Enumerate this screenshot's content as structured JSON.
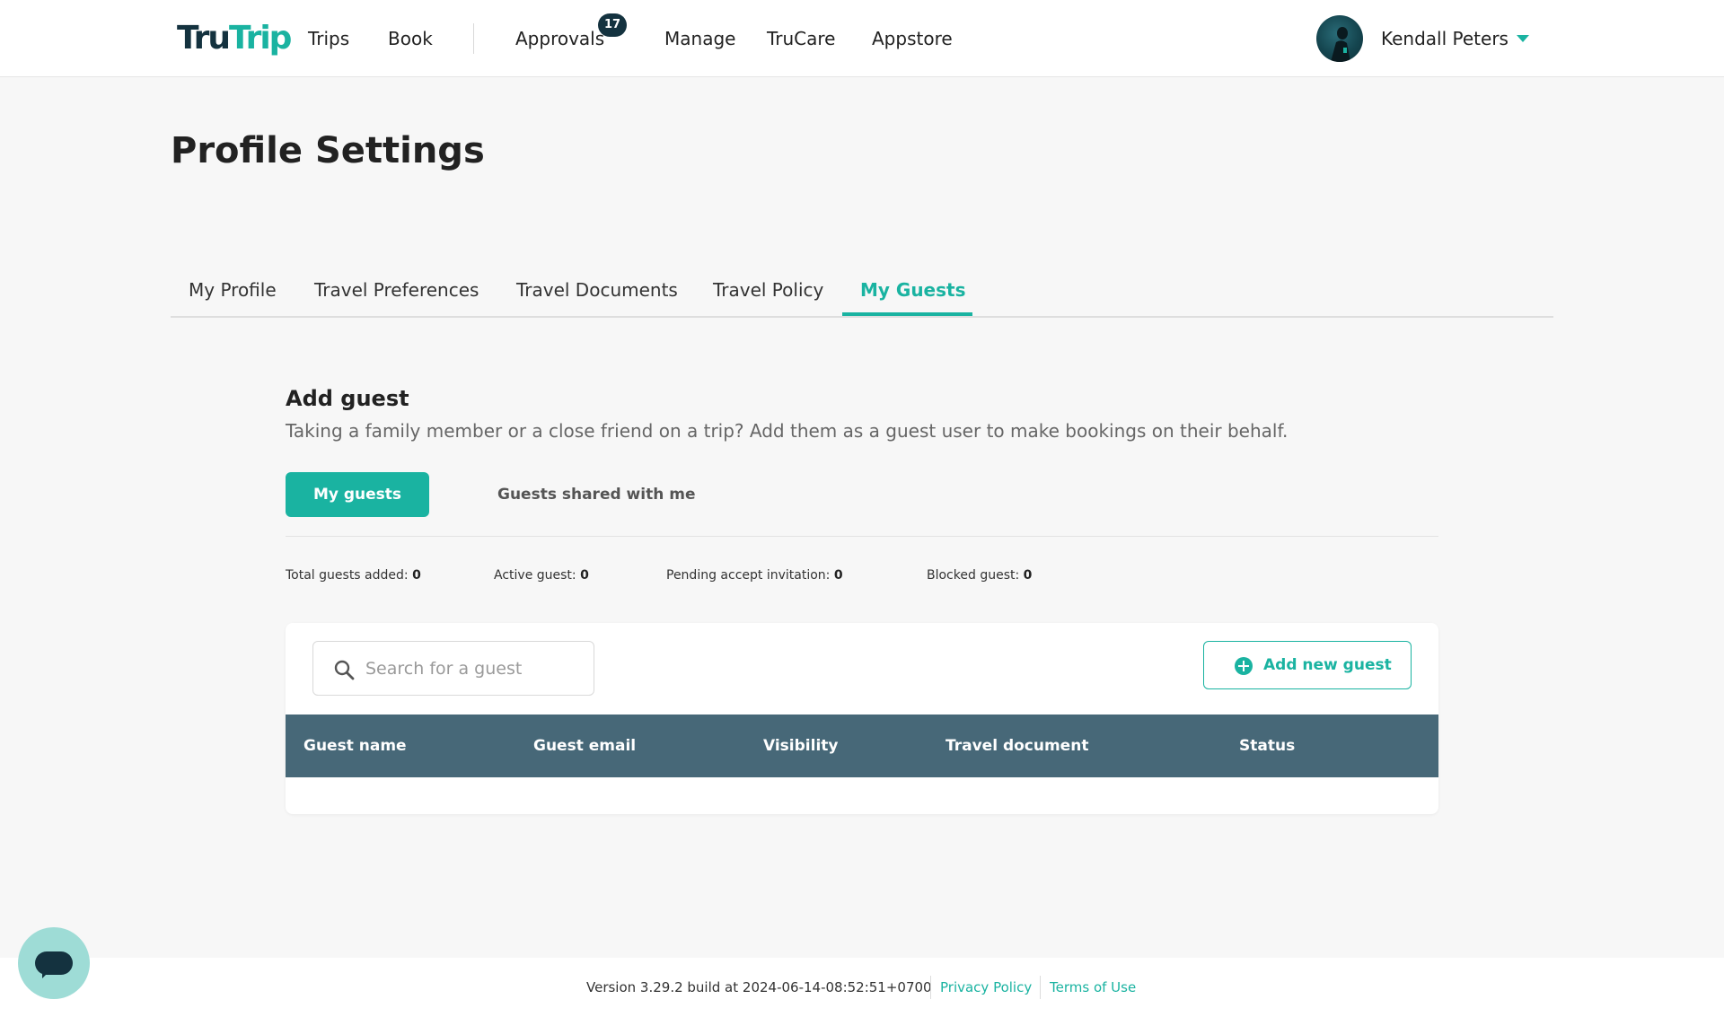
{
  "header": {
    "logo_tru": "Tru",
    "logo_trip": "Trip",
    "nav": {
      "trips": "Trips",
      "book": "Book",
      "approvals": "Approvals",
      "approvals_count": "17",
      "manage": "Manage",
      "trucare": "TruCare",
      "appstore": "Appstore"
    },
    "user_name": "Kendall Peters"
  },
  "page": {
    "title": "Profile Settings"
  },
  "tabs": {
    "my_profile": "My Profile",
    "travel_preferences": "Travel Preferences",
    "travel_documents": "Travel Documents",
    "travel_policy": "Travel Policy",
    "my_guests": "My Guests",
    "active": "My Guests"
  },
  "guests": {
    "title": "Add guest",
    "description": "Taking a family member or a close friend on a trip? Add them as a guest user to make bookings on their behalf.",
    "my_guests_label": "My guests",
    "shared_label": "Guests shared with me",
    "stats": {
      "total_label": "Total guests added:",
      "total_value": "0",
      "active_label": "Active guest:",
      "active_value": "0",
      "pending_label": "Pending accept invitation:",
      "pending_value": "0",
      "blocked_label": "Blocked guest:",
      "blocked_value": "0"
    },
    "search_placeholder": "Search for a guest",
    "add_button_label": "Add new guest",
    "columns": {
      "name": "Guest name",
      "email": "Guest email",
      "visibility": "Visibility",
      "travel_document": "Travel document",
      "status": "Status"
    }
  },
  "footer": {
    "version": "Version 3.29.2 build at 2024-06-14-08:52:51+0700",
    "privacy": "Privacy Policy",
    "terms": "Terms of Use"
  },
  "colors": {
    "accent": "#1ab3a1",
    "dark": "#14323f",
    "table_header": "#476878"
  }
}
